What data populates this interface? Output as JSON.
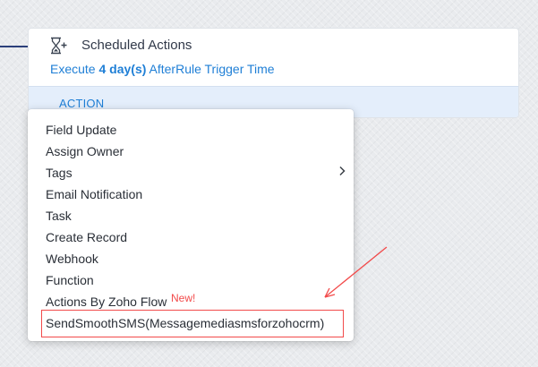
{
  "scheduled_actions": {
    "title": "Scheduled Actions",
    "execute_prefix": "Execute",
    "execute_days": "4 day(s)",
    "execute_suffix": "AfterRule Trigger Time",
    "action_label": "ACTION",
    "icon": "hourglass-add-icon"
  },
  "dropdown": {
    "items": [
      {
        "label": "Field Update"
      },
      {
        "label": "Assign Owner"
      },
      {
        "label": "Tags",
        "has_submenu": true
      },
      {
        "label": "Email Notification"
      },
      {
        "label": "Task"
      },
      {
        "label": "Create Record"
      },
      {
        "label": "Webhook"
      },
      {
        "label": "Function"
      },
      {
        "label": "Actions By Zoho Flow",
        "badge": "New!"
      },
      {
        "label": "SendSmoothSMS(Messagemediasmsforzohocrm)",
        "highlighted": true
      }
    ]
  },
  "colors": {
    "link_blue": "#1f7fd6",
    "action_bar": "#e4eefb",
    "annotation_red": "#f24a4a",
    "connector": "#2b3f7a"
  }
}
